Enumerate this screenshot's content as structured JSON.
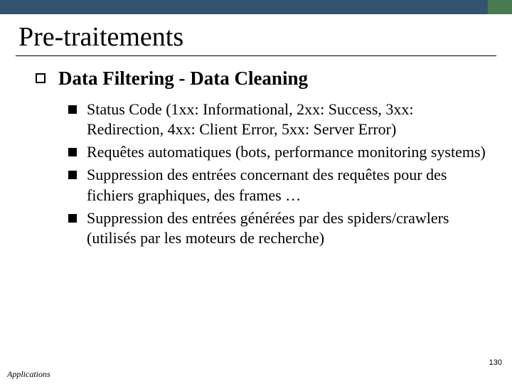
{
  "title": "Pre-traitements",
  "heading": "Data Filtering - Data Cleaning",
  "bullets": [
    "Status Code (1xx: Informational, 2xx: Success, 3xx: Redirection, 4xx: Client Error, 5xx: Server Error)",
    "Requêtes automatiques (bots, performance monitoring systems)",
    "Suppression des entrées concernant des requêtes pour des fichiers graphiques, des frames …",
    "Suppression des entrées générées par des spiders/crawlers (utilisés par les moteurs de recherche)"
  ],
  "page_number": "130",
  "footer": "Applications"
}
